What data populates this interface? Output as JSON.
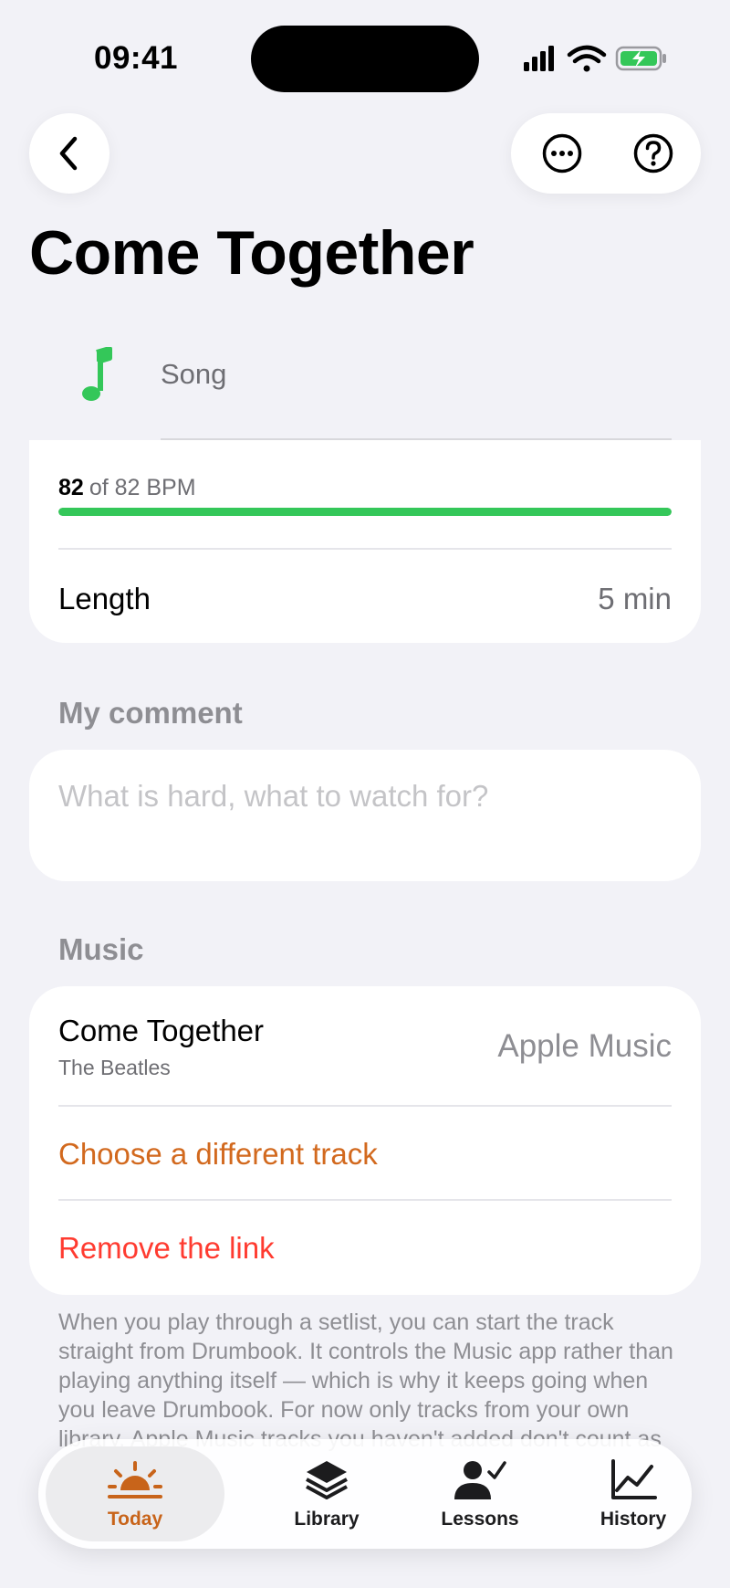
{
  "status_bar": {
    "time": "09:41"
  },
  "header": {
    "title": "Come Together"
  },
  "item_type": {
    "label": "Song",
    "icon": "music-note-icon",
    "color": "#34c759"
  },
  "tempo": {
    "current": "82",
    "of_text": "of 82 BPM",
    "progress_fraction": 1.0
  },
  "length": {
    "label": "Length",
    "value": "5 min"
  },
  "comment": {
    "header": "My comment",
    "placeholder": "What is hard, what to watch for?",
    "value": ""
  },
  "music": {
    "header": "Music",
    "track_title": "Come Together",
    "track_artist": "The Beatles",
    "source": "Apple Music",
    "choose_label": "Choose a different track",
    "remove_label": "Remove the link",
    "footnote": "When you play through a setlist, you can start the track straight from Drumbook. It controls the Music app rather than playing anything itself — which is why it keeps going when you leave Drumbook. For now only tracks from your own library. Apple Music tracks you haven't added don't count as well."
  },
  "tabs": [
    {
      "label": "Today",
      "icon": "sunrise-icon",
      "active": true
    },
    {
      "label": "Library",
      "icon": "stack-icon",
      "active": false
    },
    {
      "label": "Lessons",
      "icon": "person-check-icon",
      "active": false
    },
    {
      "label": "History",
      "icon": "chart-line-icon",
      "active": false
    }
  ],
  "colors": {
    "accent": "#c8641a",
    "destructive": "#ff3b30",
    "success": "#34c759",
    "background": "#f2f2f7"
  }
}
